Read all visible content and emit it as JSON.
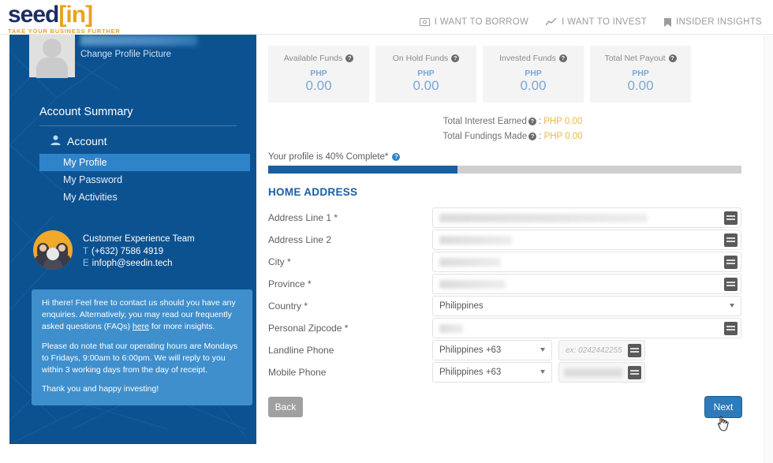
{
  "brand": {
    "logo_seed": "seed",
    "logo_bracket_open": "[",
    "logo_in": "in",
    "logo_bracket_close": "]",
    "tagline": "TAKE YOUR BUSINESS FURTHER"
  },
  "topnav": {
    "items": [
      {
        "label": "I WANT TO BORROW",
        "icon": "cash-icon"
      },
      {
        "label": "I WANT TO INVEST",
        "icon": "chart-line-icon"
      },
      {
        "label": "INSIDER INSIGHTS",
        "icon": "bookmark-icon"
      }
    ]
  },
  "sidebar": {
    "change_picture": "Change Profile Picture",
    "account_summary": "Account Summary",
    "account_label": "Account",
    "nav": [
      {
        "label": "My Profile",
        "active": true
      },
      {
        "label": "My Password",
        "active": false
      },
      {
        "label": "My Activities",
        "active": false
      }
    ],
    "support": {
      "title": "Customer Experience Team",
      "phone_key": "T",
      "phone": "(+632) 7586 4919",
      "email_key": "E",
      "email": "infoph@seedin.tech"
    },
    "info": {
      "p1_before": "Hi there! Feel free to contact us should you have any enquiries. Alternatively, you may read our frequently asked questions (FAQs) ",
      "p1_link": "here",
      "p1_after": " for more insights.",
      "p2": "Please do note that our operating hours are Mondays to Fridays, 9:00am to 6:00pm. We will reply to you within 3 working days from the day of receipt.",
      "p3": "Thank you and happy investing!"
    }
  },
  "funds": {
    "cards": [
      {
        "title": "Available Funds",
        "currency": "PHP",
        "value": "0.00"
      },
      {
        "title": "On Hold Funds",
        "currency": "PHP",
        "value": "0.00"
      },
      {
        "title": "Invested Funds",
        "currency": "PHP",
        "value": "0.00"
      },
      {
        "title": "Total Net Payout",
        "currency": "PHP",
        "value": "0.00"
      }
    ],
    "totals": [
      {
        "label": "Total Interest Earned",
        "value": "PHP 0.00"
      },
      {
        "label": "Total Fundings Made",
        "value": "PHP 0.00"
      }
    ]
  },
  "progress": {
    "label": "Your profile is 40% Complete*",
    "percent": 40
  },
  "form": {
    "section_title": "HOME ADDRESS",
    "fields": [
      {
        "label": "Address Line 1 *",
        "type": "text",
        "value": "",
        "redacted": true,
        "redacted_width": 264
      },
      {
        "label": "Address Line 2",
        "type": "text",
        "value": "",
        "redacted": true,
        "redacted_width": 92
      },
      {
        "label": "City *",
        "type": "text",
        "value": "",
        "redacted": true,
        "redacted_width": 78
      },
      {
        "label": "Province *",
        "type": "text",
        "value": "",
        "redacted": true,
        "redacted_width": 84
      },
      {
        "label": "Country *",
        "type": "select",
        "value": "Philippines"
      },
      {
        "label": "Personal Zipcode *",
        "type": "text",
        "value": "",
        "redacted": true,
        "redacted_width": 30
      },
      {
        "label": "Landline Phone",
        "type": "phone",
        "code": "Philippines +63",
        "placeholder": "ex: 0242442255",
        "value": ""
      },
      {
        "label": "Mobile Phone",
        "type": "phone",
        "code": "Philippines +63",
        "placeholder": "",
        "value": "",
        "redacted": true
      }
    ],
    "back_label": "Back",
    "next_label": "Next"
  },
  "colors": {
    "brand_navy": "#1b2d63",
    "brand_gold": "#e8a322",
    "sidebar_blue": "#0c5291",
    "accent_blue": "#2f83c9",
    "progress_fill": "#1a5fa0",
    "value_blue": "#7ba7d4",
    "total_gold": "#e8b84b"
  }
}
